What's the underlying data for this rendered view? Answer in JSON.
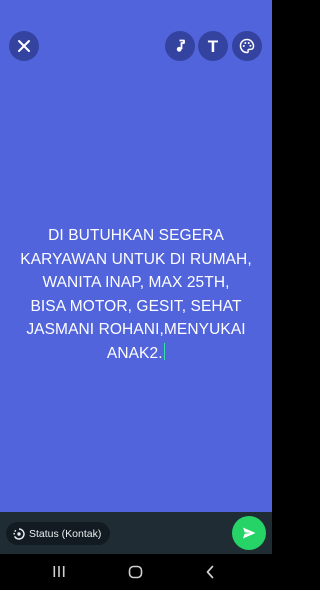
{
  "status": {
    "text_lines": [
      "DI BUTUHKAN SEGERA",
      "KARYAWAN UNTUK DI RUMAH,",
      "WANITA INAP, MAX 25TH,",
      "BISA MOTOR, GESIT, SEHAT",
      "JASMANI ROHANI,MENYUKAI",
      "ANAK2."
    ],
    "background_color": "#5164DC",
    "text_color": "#FFFFFF"
  },
  "toolbar": {
    "close_icon": "close-icon",
    "music_icon": "music-note-icon",
    "text_label": "T",
    "palette_icon": "palette-icon"
  },
  "footer": {
    "audience_label": "Status (Kontak)",
    "audience_icon": "status-ring-icon",
    "send_icon": "send-icon",
    "send_color": "#25D366"
  },
  "navigation": {
    "recents_icon": "recents-icon",
    "home_icon": "home-icon",
    "back_icon": "back-icon"
  }
}
